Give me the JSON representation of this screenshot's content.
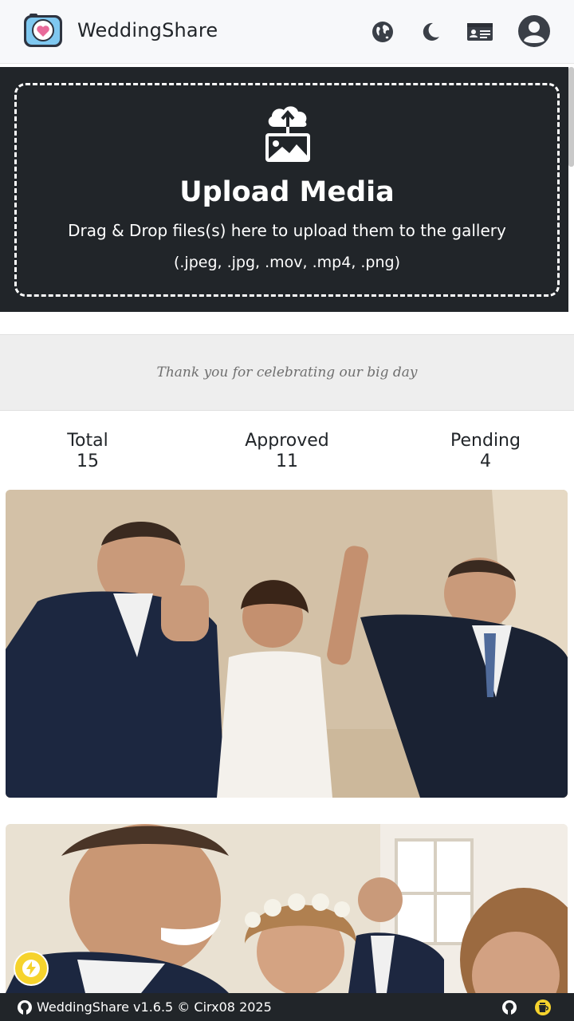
{
  "header": {
    "brand": "WeddingShare",
    "icons": [
      "globe-icon",
      "moon-icon",
      "id-card-icon",
      "account-icon"
    ]
  },
  "upload": {
    "title": "Upload Media",
    "subtitle": "Drag & Drop files(s) here to upload them to the gallery",
    "formats": "(.jpeg, .jpg, .mov, .mp4, .png)"
  },
  "banner": {
    "text": "Thank you for celebrating our big day"
  },
  "stats": [
    {
      "label": "Total",
      "value": "15"
    },
    {
      "label": "Approved",
      "value": "11"
    },
    {
      "label": "Pending",
      "value": "4"
    }
  ],
  "footer": {
    "text": "WeddingShare v1.6.5 © Cirx08 2025"
  },
  "colors": {
    "dark": "#212529",
    "accent": "#f6d32d",
    "banner_bg": "#eeeeee"
  }
}
